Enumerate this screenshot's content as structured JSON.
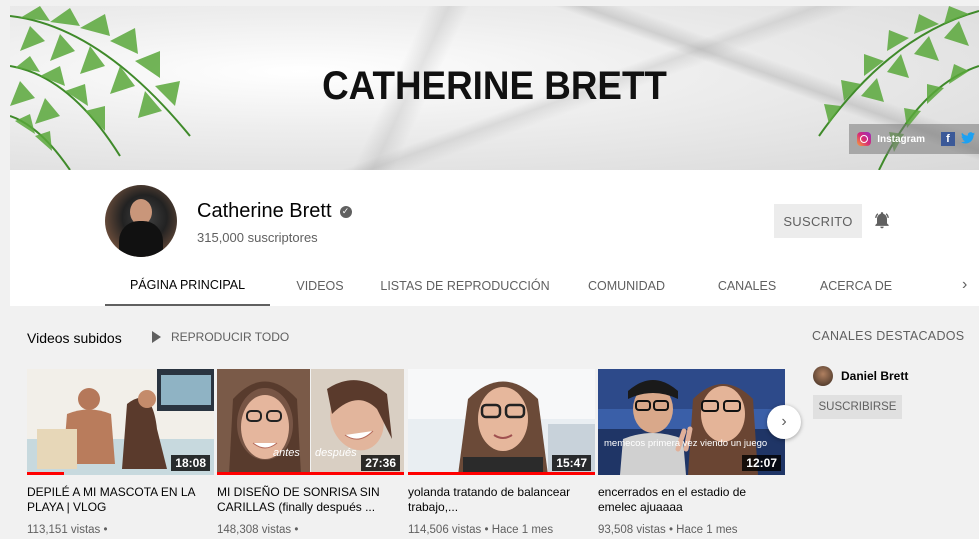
{
  "banner": {
    "title": "CATHERINE BRETT",
    "links": [
      {
        "label": "Instagram",
        "icon": "instagram-icon"
      },
      {
        "label": "",
        "icon": "facebook-icon"
      },
      {
        "label": "",
        "icon": "twitter-icon"
      }
    ]
  },
  "channel": {
    "name": "Catherine Brett",
    "subscribers": "315,000 suscriptores",
    "subscribe_label": "SUSCRITO",
    "verified_icon": "verified-check-icon",
    "bell_icon": "notification-bell-icon"
  },
  "tabs": [
    {
      "label": "PÁGINA PRINCIPAL",
      "active": true
    },
    {
      "label": "VIDEOS"
    },
    {
      "label": "LISTAS DE REPRODUCCIÓN"
    },
    {
      "label": "COMUNIDAD"
    },
    {
      "label": "CANALES"
    },
    {
      "label": "ACERCA DE"
    }
  ],
  "section": {
    "title": "Videos subidos",
    "play_all": "REPRODUCIR TODO"
  },
  "videos": [
    {
      "title": "DEPILÉ A MI MASCOTA EN LA PLAYA | VLOG",
      "duration": "18:08",
      "meta": "113,151 vistas •"
    },
    {
      "title": "MI DISEÑO DE SONRISA SIN CARILLAS (finally después ...",
      "duration": "27:36",
      "meta": "148,308 vistas •",
      "overlay_left": "antes",
      "overlay_right": "después"
    },
    {
      "title": "yolanda tratando de balancear trabajo,...",
      "duration": "15:47",
      "meta": "114,506 vistas • Hace 1 mes"
    },
    {
      "title": "encerrados en el estadio de emelec ajuaaaa",
      "duration": "12:07",
      "meta": "93,508 vistas • Hace 1 mes",
      "overlay_caption": "memecos primera vez viendo un juego"
    }
  ],
  "featured": {
    "title": "CANALES DESTACADOS",
    "channel_name": "Daniel Brett",
    "subscribe_label": "SUSCRIBIRSE"
  },
  "colors": {
    "accent_red": "#ff0000",
    "text_secondary": "#606060"
  }
}
